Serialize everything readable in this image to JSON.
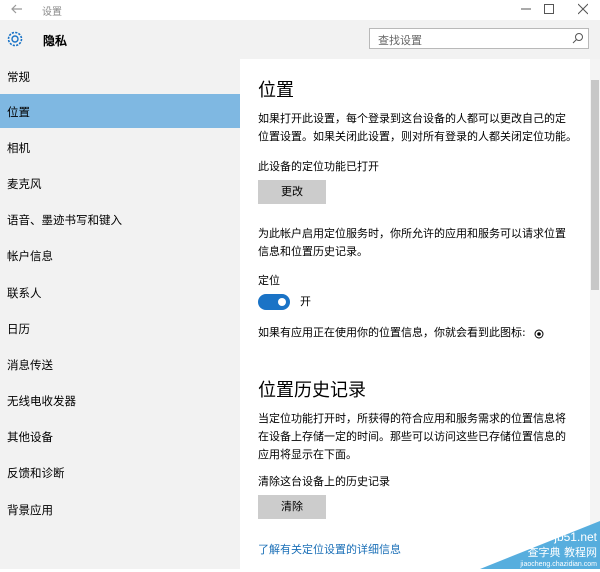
{
  "window": {
    "title": "设置"
  },
  "header": {
    "title": "隐私",
    "search_placeholder": "查找设置"
  },
  "sidebar": {
    "items": [
      {
        "label": "常规",
        "active": false
      },
      {
        "label": "位置",
        "active": true
      },
      {
        "label": "相机",
        "active": false
      },
      {
        "label": "麦克风",
        "active": false
      },
      {
        "label": "语音、墨迹书写和键入",
        "active": false
      },
      {
        "label": "帐户信息",
        "active": false
      },
      {
        "label": "联系人",
        "active": false
      },
      {
        "label": "日历",
        "active": false
      },
      {
        "label": "消息传送",
        "active": false
      },
      {
        "label": "无线电收发器",
        "active": false
      },
      {
        "label": "其他设备",
        "active": false
      },
      {
        "label": "反馈和诊断",
        "active": false
      },
      {
        "label": "背景应用",
        "active": false
      }
    ]
  },
  "location": {
    "heading": "位置",
    "desc_line1": "如果打开此设置，每个登录到这台设备的人都可以更改自己的定",
    "desc_line2": "位置设置。如果关闭此设置，则对所有登录的人都关闭定位功能。",
    "device_status": "此设备的定位功能已打开",
    "change_button": "更改",
    "account_line1": "为此帐户启用定位服务时，你所允许的应用和服务可以请求位置",
    "account_line2": "信息和位置历史记录。",
    "toggle_label": "定位",
    "toggle_state": "开",
    "indicator_text": "如果有应用正在使用你的位置信息，你就会看到此图标:"
  },
  "history": {
    "heading": "位置历史记录",
    "desc_line1": "当定位功能打开时，所获得的符合应用和服务需求的位置信息将",
    "desc_line2": "在设备上存储一定的时间。那些可以访问这些已存储位置信息的",
    "desc_line3": "应用将显示在下面。",
    "clear_label": "清除这台设备上的历史记录",
    "clear_button": "清除",
    "learn_more": "了解有关定位设置的详细信息"
  },
  "watermark": {
    "line1": "jb51.net",
    "line2": "查字典 教程网",
    "line3": "jiaocheng.chazidian.com"
  },
  "colors": {
    "accent": "#1a73c6",
    "active_nav": "#7fb8e2",
    "link": "#1a6fb7"
  }
}
